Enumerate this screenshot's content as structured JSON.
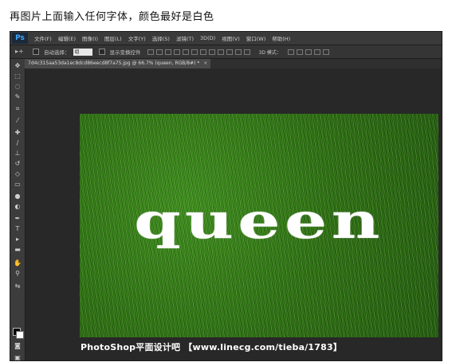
{
  "instruction": "再图片上面输入任何字体，颜色最好是白色",
  "app": {
    "logo": "Ps",
    "menu": [
      "文件(F)",
      "编辑(E)",
      "图像(I)",
      "图层(L)",
      "文字(Y)",
      "选择(S)",
      "滤镜(T)",
      "3D(D)",
      "视图(V)",
      "窗口(W)",
      "帮助(H)"
    ]
  },
  "options": {
    "auto_select_label": "自动选择：",
    "auto_select_value": "组",
    "transform_label": "显示变换控件",
    "mode_3d_label": "3D 模式："
  },
  "document": {
    "tab_title": "7d4c315aa53da1ec8dcd86eecd8f7a75.jpg @ 66.7% (queen, RGB/8#) *",
    "tab_close": "×",
    "canvas_text": "queen"
  },
  "watermark": "PhotoShop平面设计吧 【www.linecg.com/tieba/1783】",
  "colors": {
    "foreground": "#000000",
    "background": "#ffffff",
    "grass": "#2e7014"
  },
  "tools": [
    "move-icon",
    "marquee-icon",
    "lasso-icon",
    "quick-select-icon",
    "crop-icon",
    "eyedropper-icon",
    "healing-icon",
    "brush-icon",
    "stamp-icon",
    "history-brush-icon",
    "eraser-icon",
    "gradient-icon",
    "blur-icon",
    "dodge-icon",
    "pen-icon",
    "type-icon",
    "path-select-icon",
    "shape-icon",
    "hand-icon",
    "zoom-icon"
  ]
}
